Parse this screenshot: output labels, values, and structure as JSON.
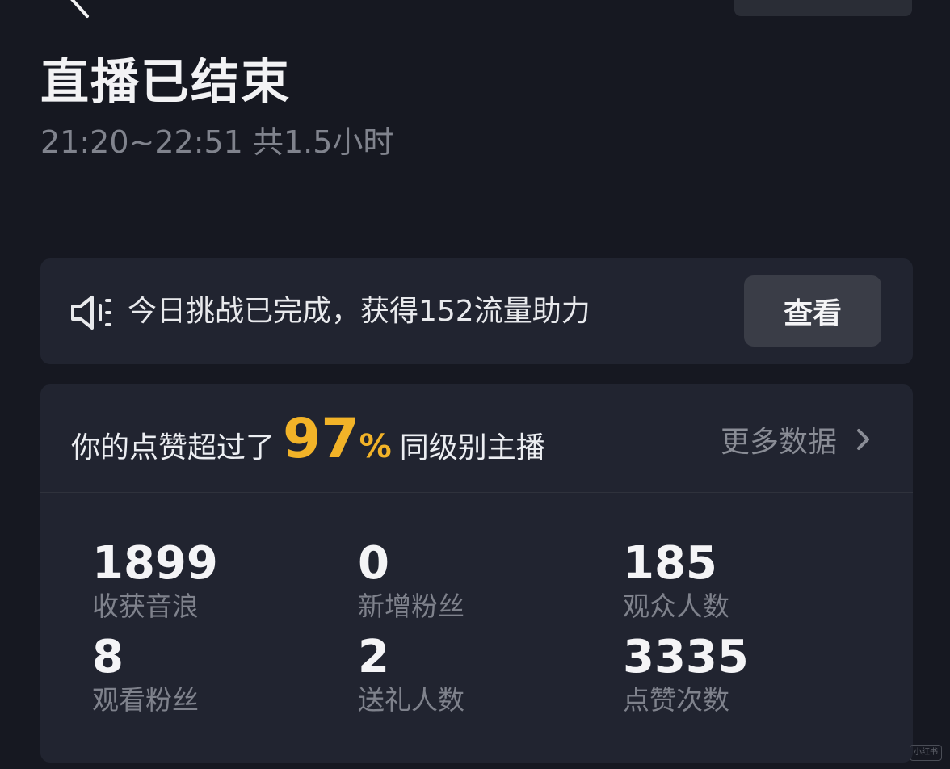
{
  "header": {
    "title": "直播已结束",
    "time_range": "21:20~22:51 共1.5小时"
  },
  "challenge": {
    "icon": "speaker-icon",
    "text": "今日挑战已完成，获得152流量助力",
    "button_label": "查看"
  },
  "comparison": {
    "prefix": "你的点赞超过了",
    "value": "97",
    "unit": "%",
    "suffix": "同级别主播",
    "more_label": "更多数据",
    "accent_color": "#f2b328"
  },
  "stats": [
    {
      "value": "1899",
      "label": "收获音浪"
    },
    {
      "value": "0",
      "label": "新增粉丝"
    },
    {
      "value": "185",
      "label": "观众人数"
    },
    {
      "value": "8",
      "label": "观看粉丝"
    },
    {
      "value": "2",
      "label": "送礼人数"
    },
    {
      "value": "3335",
      "label": "点赞次数"
    }
  ],
  "watermark": "小红书"
}
